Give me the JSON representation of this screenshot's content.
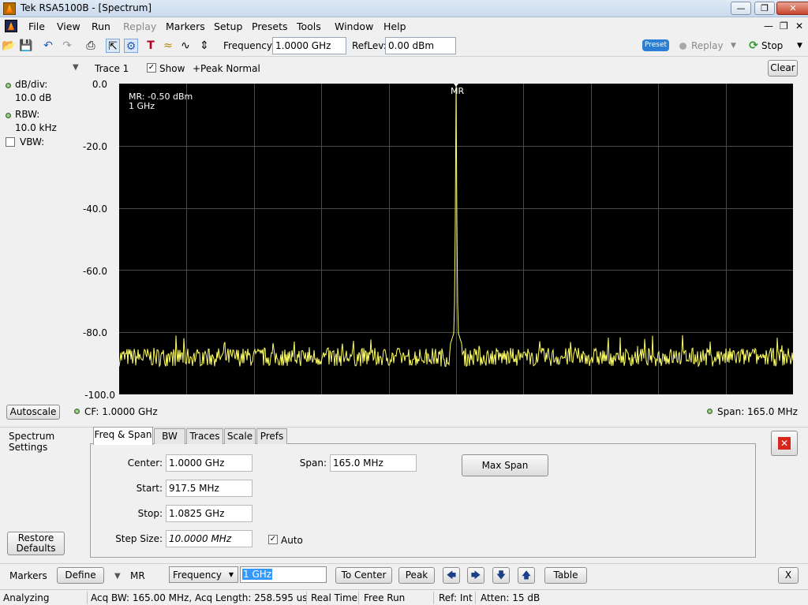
{
  "window": {
    "title": "Tek RSA5100B - [Spectrum]"
  },
  "menu": [
    "File",
    "View",
    "Run",
    "Replay",
    "Markers",
    "Setup",
    "Presets",
    "Tools",
    "Window",
    "Help"
  ],
  "toolbar": {
    "frequency_label": "Frequency:",
    "frequency_value": "1.0000 GHz",
    "reflev_label": "RefLev:",
    "reflev_value": "0.00 dBm",
    "preset": "Preset",
    "replay": "Replay",
    "stop": "Stop"
  },
  "trace": {
    "name": "Trace 1",
    "show_label": "Show",
    "detection": "+Peak Normal",
    "clear": "Clear"
  },
  "left_readouts": {
    "dbdiv_label": "dB/div:",
    "dbdiv_value": "10.0 dB",
    "rbw_label": "RBW:",
    "rbw_value": "10.0 kHz",
    "vbw_label": "VBW:"
  },
  "plot": {
    "marker_readout_1": "MR: -0.50 dBm",
    "marker_readout_2": "1 GHz",
    "marker_label": "MR",
    "y_ticks": [
      "0.0",
      "-20.0",
      "-40.0",
      "-60.0",
      "-80.0",
      "-100.0"
    ],
    "cf": "CF:  1.0000 GHz",
    "span": "Span:  165.0 MHz",
    "autoscale": "Autoscale",
    "trace_color": "#ffff66"
  },
  "chart_data": {
    "type": "line",
    "x_center_ghz": 1.0,
    "span_mhz": 165.0,
    "ylim": [
      -100,
      0
    ],
    "y_ticks": [
      0,
      -20,
      -40,
      -60,
      -80,
      -100
    ],
    "peak": {
      "freq_ghz": 1.0,
      "level_dbm": -0.5
    },
    "noise_floor_dbm": -88
  },
  "settings": {
    "title_line1": "Spectrum",
    "title_line2": "Settings",
    "restore_line1": "Restore",
    "restore_line2": "Defaults",
    "tabs": [
      "Freq & Span",
      "BW",
      "Traces",
      "Scale",
      "Prefs"
    ],
    "center_label": "Center:",
    "center_value": "1.0000 GHz",
    "start_label": "Start:",
    "start_value": "917.5 MHz",
    "stop_label": "Stop:",
    "stop_value": "1.0825 GHz",
    "step_label": "Step Size:",
    "step_value": "10.0000 MHz",
    "auto_label": "Auto",
    "span_label": "Span:",
    "span_value": "165.0 MHz",
    "maxspan": "Max Span"
  },
  "markers": {
    "label": "Markers",
    "define": "Define",
    "marker_name": "MR",
    "type_select": "Frequency",
    "value": "1 GHz",
    "to_center": "To Center",
    "peak": "Peak",
    "table": "Table",
    "close": "X"
  },
  "status": {
    "state": "Analyzing",
    "acq": "Acq BW: 165.00 MHz, Acq Length: 258.595 us",
    "mode": "Real Time",
    "trigger": "Free Run",
    "ref": "Ref: Int",
    "atten": "Atten: 15 dB"
  }
}
